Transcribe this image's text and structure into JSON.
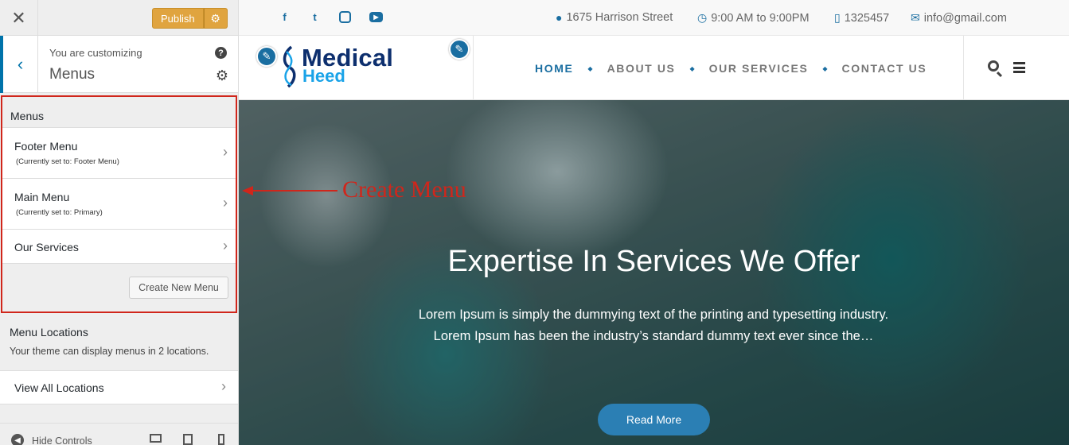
{
  "sidebar": {
    "close_icon": "close-icon",
    "publish_label": "Publish",
    "customizing_label": "You are customizing",
    "section_title": "Menus",
    "menus_heading": "Menus",
    "menu_items": [
      {
        "title": "Footer Menu",
        "subtitle": "(Currently set to: Footer Menu)"
      },
      {
        "title": "Main Menu",
        "subtitle": "(Currently set to: Primary)"
      },
      {
        "title": "Our Services",
        "subtitle": ""
      }
    ],
    "create_button": "Create New Menu",
    "locations_title": "Menu Locations",
    "locations_desc": "Your theme can display menus in 2 locations.",
    "view_all_label": "View All Locations",
    "hide_controls": "Hide Controls",
    "accent_color": "#0073aa",
    "publish_color": "#e0a43f"
  },
  "preview": {
    "topbar": {
      "address": "1675 Harrison Street",
      "hours": "9:00 AM to 9:00PM",
      "phone": "1325457",
      "email": "info@gmail.com"
    },
    "logo": {
      "line1": "Medical",
      "line2": "Heed"
    },
    "nav": [
      "HOME",
      "ABOUT US",
      "OUR SERVICES",
      "CONTACT US"
    ],
    "hero": {
      "title": "Expertise In Services We Offer",
      "text": "Lorem Ipsum is simply the dummying text of the printing and typesetting industry. Lorem Ipsum has been the industry’s standard dummy text ever since the…",
      "button": "Read More"
    },
    "brand_color": "#1a6ea1"
  },
  "annotation": {
    "text": "Create Menu",
    "color": "#d0261b"
  }
}
